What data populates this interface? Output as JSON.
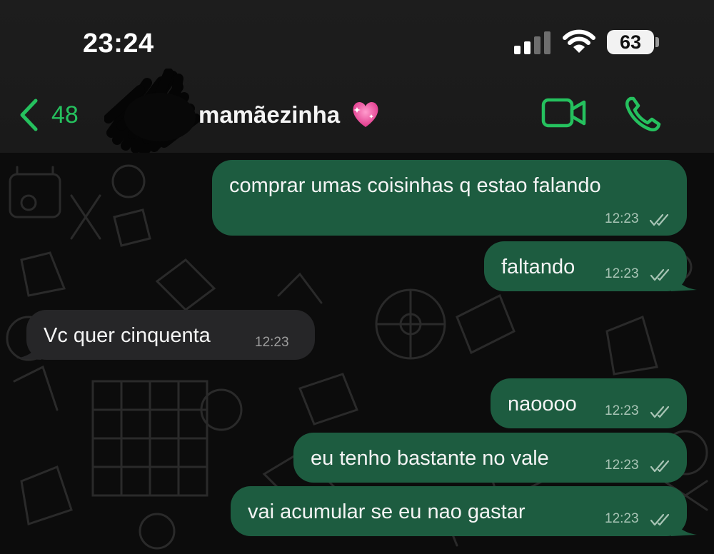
{
  "status_bar": {
    "time": "23:24",
    "battery": "63",
    "icons": [
      "signal-icon",
      "wifi-icon",
      "battery-icon"
    ]
  },
  "header": {
    "back_count": "48",
    "contact_name": "mamãezinha",
    "contact_emoji": "sparkling-heart",
    "actions": [
      "video-call-icon",
      "phone-icon"
    ]
  },
  "colors": {
    "accent": "#25c15e",
    "outgoing_bubble": "#1d5c40",
    "incoming_bubble": "#262628",
    "background": "#0c0c0c"
  },
  "messages": [
    {
      "direction": "out",
      "text": "comprar umas coisinhas q estao falando",
      "time": "12:23",
      "read": true
    },
    {
      "direction": "out",
      "text": "faltando",
      "time": "12:23",
      "read": true
    },
    {
      "direction": "in",
      "text": "Vc quer cinquenta",
      "time": "12:23"
    },
    {
      "direction": "out",
      "text": "naoooo",
      "time": "12:23",
      "read": true
    },
    {
      "direction": "out",
      "text": "eu tenho bastante no vale",
      "time": "12:23",
      "read": true
    },
    {
      "direction": "out",
      "text": "vai acumular se eu nao gastar",
      "time": "12:23",
      "read": true
    }
  ]
}
